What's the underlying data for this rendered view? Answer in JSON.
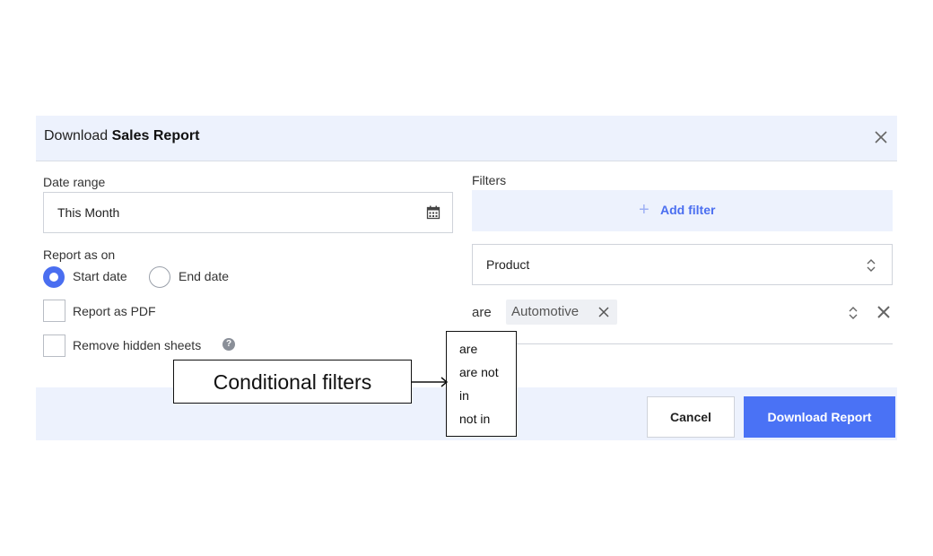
{
  "dialog": {
    "title_prefix": "Download",
    "title_bold": "Sales Report",
    "close_icon": "close-icon"
  },
  "left": {
    "date_range_label": "Date range",
    "date_range_value": "This Month",
    "calendar_icon": "calendar-icon",
    "report_as_on_label": "Report as on",
    "radio_start": "Start date",
    "radio_end": "End date",
    "radio_selected": "Start date",
    "checkbox_pdf": "Report as PDF",
    "checkbox_hidden": "Remove hidden sheets",
    "help_glyph": "?"
  },
  "right": {
    "filters_label": "Filters",
    "add_filter_plus": "+",
    "add_filter_label": "Add filter",
    "product_select_value": "Product",
    "condition_value": "are",
    "chip_value": "Automotive"
  },
  "footer": {
    "cancel_label": "Cancel",
    "download_label": "Download Report"
  },
  "dropdown": {
    "options": [
      "are",
      "are not",
      "in",
      "not in"
    ]
  },
  "callout": {
    "text": "Conditional filters"
  },
  "colors": {
    "accent": "#4a72f5",
    "header_bg": "#edf2fd"
  }
}
